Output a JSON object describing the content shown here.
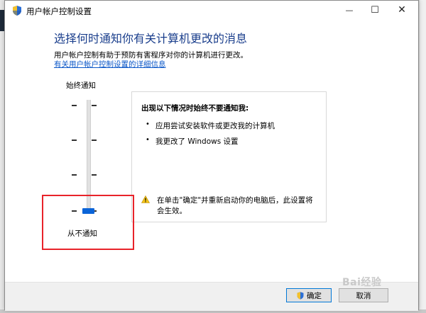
{
  "window": {
    "title": "用户帐户控制设置",
    "controls": {
      "minimize": "—",
      "maximize": "☐",
      "close": "✕"
    }
  },
  "content": {
    "heading": "选择何时通知你有关计算机更改的消息",
    "description": "用户帐户控制有助于预防有害程序对你的计算机进行更改。",
    "link": "有关用户帐户控制设置的详细信息"
  },
  "slider": {
    "top_label": "始终通知",
    "bottom_label": "从不通知",
    "levels": 4,
    "selected_level": 1
  },
  "info_panel": {
    "title": "出现以下情况时始终不要通知我:",
    "bullets": [
      "应用尝试安装软件或更改我的计算机",
      "我更改了 Windows 设置"
    ],
    "bullet_char": "•",
    "warning": "在单击\"确定\"并重新启动你的电脑后，此设置将会生效。"
  },
  "buttons": {
    "ok": "确定",
    "cancel": "取消"
  },
  "watermark": "Bai经验",
  "colors": {
    "heading": "#1a3e8c",
    "link": "#0b57c8",
    "thumb": "#0a64d8",
    "highlight": "#e8232a"
  }
}
